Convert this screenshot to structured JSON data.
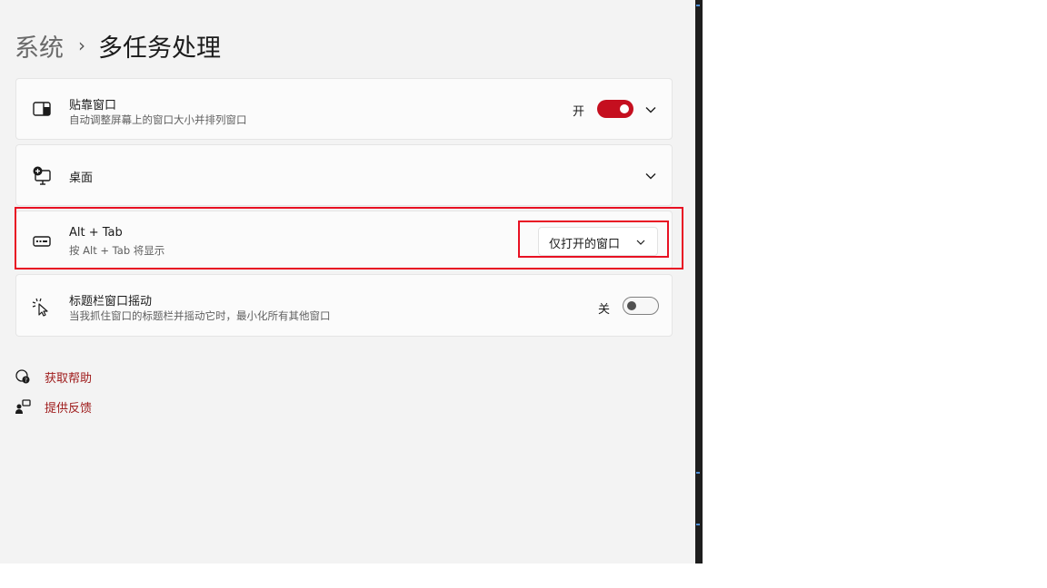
{
  "breadcrumb": {
    "parent": "系统",
    "separator": "›",
    "current": "多任务处理"
  },
  "cards": [
    {
      "title": "贴靠窗口",
      "description": "自动调整屏幕上的窗口大小并排列窗口",
      "toggle_label": "开",
      "toggle_state": "on",
      "icon": "snap-window-icon"
    },
    {
      "title": "桌面",
      "icon": "desktop-icon"
    },
    {
      "title": "Alt + Tab",
      "description": "按 Alt + Tab 将显示",
      "dropdown_value": "仅打开的窗口",
      "icon": "alt-tab-icon"
    },
    {
      "title": "标题栏窗口摇动",
      "description": "当我抓住窗口的标题栏并摇动它时，最小化所有其他窗口",
      "toggle_label": "关",
      "toggle_state": "off",
      "icon": "shake-cursor-icon"
    }
  ],
  "links": [
    {
      "label": "获取帮助",
      "icon": "help-icon"
    },
    {
      "label": "提供反馈",
      "icon": "feedback-icon"
    }
  ],
  "colors": {
    "accent": "#c50f1f",
    "link": "#9e1a1a",
    "highlight": "#e81123",
    "background": "#f3f3f3",
    "card": "#fbfbfb"
  }
}
